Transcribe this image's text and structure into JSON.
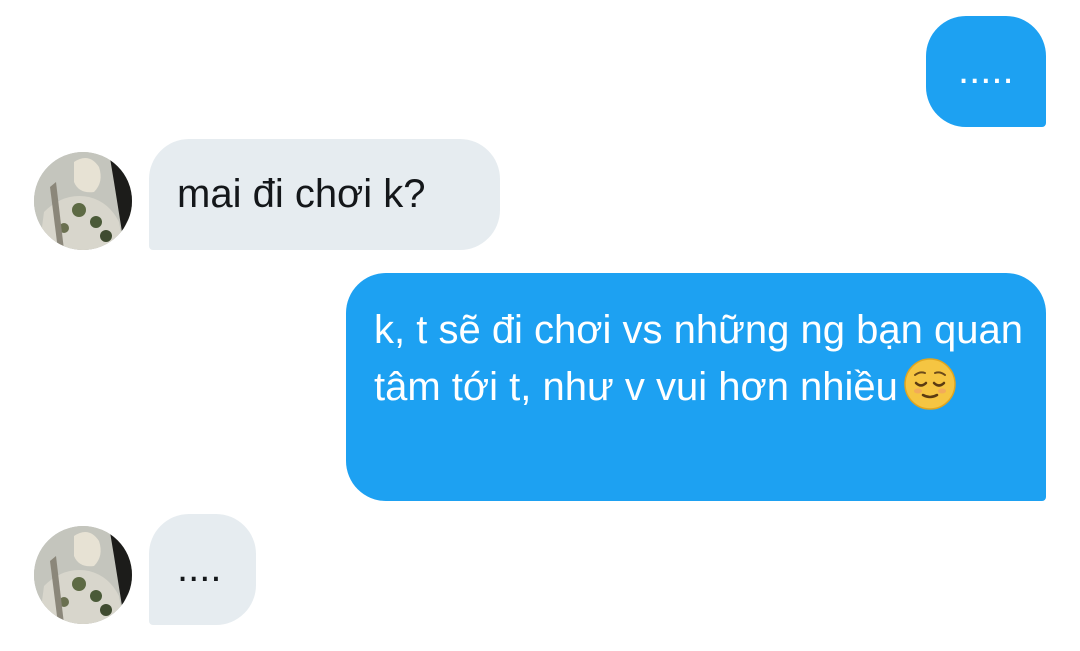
{
  "conversation": {
    "messages": [
      {
        "sender": "me",
        "text": "....."
      },
      {
        "sender": "other",
        "text": "mai đi chơi k?"
      },
      {
        "sender": "me",
        "text": "k, t sẽ đi chơi vs những ng bạn quan tâm tới t, như v vui hơn nhiều",
        "emoji": "relieved-face"
      },
      {
        "sender": "other",
        "text": "...."
      }
    ]
  },
  "colors": {
    "sent_bubble": "#1da1f2",
    "received_bubble": "#e6ecf0",
    "sent_text": "#ffffff",
    "received_text": "#14171a"
  }
}
